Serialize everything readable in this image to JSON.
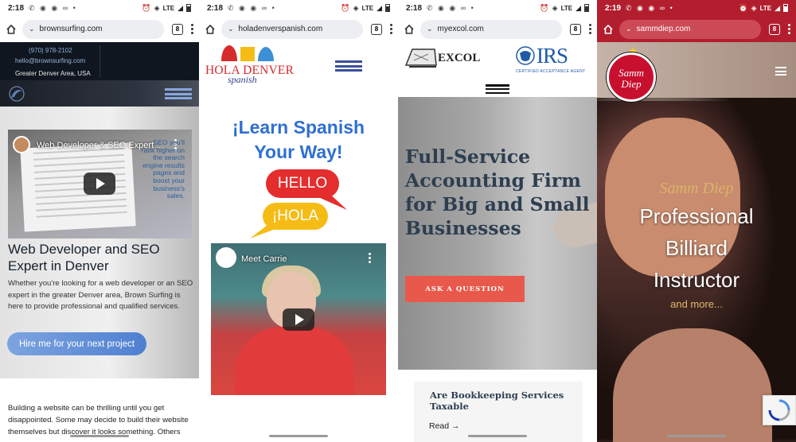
{
  "colors": {
    "brownsurfing_button": "#5b87d6",
    "hola_blue": "#2f6fd1",
    "hello_red": "#e42d2d",
    "hola_yellow": "#f5bc16",
    "excol_button": "#e8594b",
    "sammdiep_toolbar": "#b31e2e"
  },
  "panels": [
    {
      "status": {
        "time": "2:18",
        "network": "LTE"
      },
      "browser": {
        "url": "brownsurfing.com",
        "tab_count": "8"
      },
      "page": {
        "phone": "(970) 978-2102",
        "email": "hello@brownsurfing.com",
        "location": "Greater Denver Area, USA",
        "video_title": "Web Developer & SEO Expert ...",
        "video_side_text": "SEO you'll rank higher on the search engine results pages and boost your business's sales.",
        "video_corner": "SEO",
        "heading": "Web Developer and SEO Expert in Denver",
        "description": "Whether you're looking for a web developer or an SEO expert in the greater Denver area, Brown Surfing is here to provide professional and qualified services.",
        "cta": "Hire me for your next project",
        "intro": "Building a website can be thrilling until you get disappointed. Some may decide to build their website themselves but discover it looks something. Others"
      }
    },
    {
      "status": {
        "time": "2:18",
        "network": "LTE"
      },
      "browser": {
        "url": "holadenverspanish.com",
        "tab_count": "8"
      },
      "page": {
        "logo_text": "HOLA DENVER",
        "logo_script": "spanish",
        "heading_line1": "¡Learn Spanish",
        "heading_line2": "Your Way!",
        "bubble_hello": "HELLO",
        "bubble_hola": "¡HOLA",
        "video_title": "Meet Carrie"
      }
    },
    {
      "status": {
        "time": "2:18",
        "network": "LTE"
      },
      "browser": {
        "url": "myexcol.com",
        "tab_count": "8"
      },
      "page": {
        "logo_excol": "EXCOL",
        "logo_irs": "IRS",
        "irs_sub": "CERTIFIED ACCEPTANCE AGENT",
        "heading": "Full-Service Accounting Firm for Big and Small Businesses",
        "cta": "ASK A QUESTION",
        "card_title": "Are Bookkeeping Services Taxable",
        "card_link": "Read →"
      }
    },
    {
      "status": {
        "time": "2:19",
        "network": "LTE"
      },
      "browser": {
        "url": "sammdiep.com",
        "tab_count": "8"
      },
      "page": {
        "logo_text": "Samm Diep",
        "signature": "Samm Diep",
        "heading_line1": "Professional",
        "heading_line2": "Billiard",
        "heading_line3": "Instructor",
        "more": "and more..."
      }
    }
  ]
}
